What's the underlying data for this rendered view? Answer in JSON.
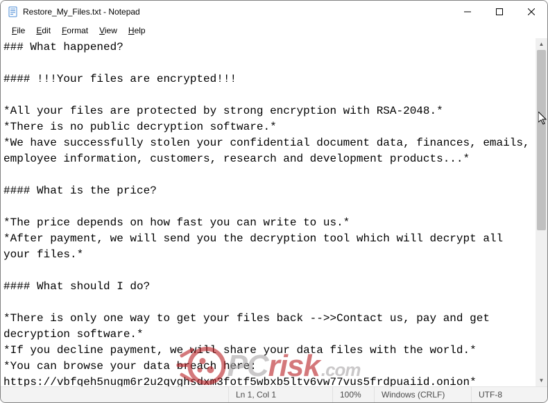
{
  "window": {
    "title": "Restore_My_Files.txt - Notepad"
  },
  "menu": {
    "file": "File",
    "edit": "Edit",
    "format": "Format",
    "view": "View",
    "help": "Help"
  },
  "content": "### What happened?\n\n#### !!!Your files are encrypted!!!\n\n*All your files are protected by strong encryption with RSA-2048.*\n*There is no public decryption software.*\n*We have successfully stolen your confidential document data, finances, emails, employee information, customers, research and development products...*\n\n#### What is the price?\n\n*The price depends on how fast you can write to us.*\n*After payment, we will send you the decryption tool which will decrypt all your files.*\n\n#### What should I do?\n\n*There is only one way to get your files back -->>Contact us, pay and get decryption software.*\n*If you decline payment, we will share your data files with the world.*\n*You can browse your data breach here:\nhttps://vbfqeh5nugm6r2u2qvghsdxm3fotf5wbxb5ltv6vw77vus5frdpuaiid.onion*\n(You should download and install TOR browser first hxxps://torproject.org)",
  "status": {
    "ln": "Ln 1, Col 1",
    "zoom": "100%",
    "eol": "Windows (CRLF)",
    "encoding": "UTF-8"
  },
  "watermark": {
    "pc": "PC",
    "risk": "risk",
    "com": ".com"
  }
}
